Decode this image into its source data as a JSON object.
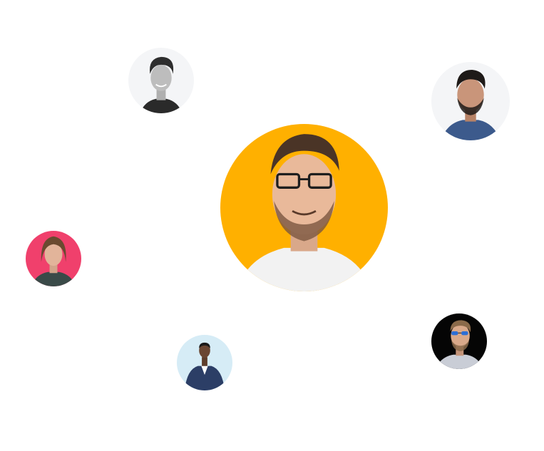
{
  "avatars": [
    {
      "id": "center",
      "background": "#FFB000",
      "shirt": "#F2F2F2",
      "hair": "#4A3426",
      "skin": "#E9B99A",
      "glasses": true
    },
    {
      "id": "topleft",
      "background": "#F4F5F7",
      "shirt": "#2A2A2A",
      "hair": "#2E2E2E",
      "skin": "#BDBDBD"
    },
    {
      "id": "topright",
      "background": "#F4F5F7",
      "shirt": "#3C5A8C",
      "hair": "#1E1A18",
      "skin": "#C9957A"
    },
    {
      "id": "left",
      "background": "#F0406C",
      "shirt": "#3A4A48",
      "hair": "#6A4A30",
      "skin": "#E2B49A"
    },
    {
      "id": "bottom",
      "background": "#D6ECF6",
      "shirt": "#2C3E66",
      "hair": "#1A1A1A",
      "skin": "#6A4632"
    },
    {
      "id": "right",
      "background": "#050505",
      "shirt": "#C9CDD6",
      "hair": "#8A6A4A",
      "skin": "#D9A98A",
      "sunglasses": true
    }
  ]
}
